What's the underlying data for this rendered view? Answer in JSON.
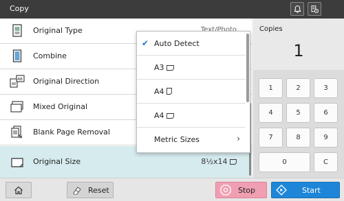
{
  "header": {
    "title": "Copy",
    "bell_icon": "bell-icon",
    "job_status_icon": "job-status-icon"
  },
  "settings": [
    {
      "label": "Original Type",
      "value": "Text/Photo",
      "icon": "original-type-icon"
    },
    {
      "label": "Combine",
      "value": "",
      "icon": "combine-icon"
    },
    {
      "label": "Original Direction",
      "value": "",
      "icon": "original-direction-icon"
    },
    {
      "label": "Mixed Original",
      "value": "",
      "icon": "mixed-original-icon"
    },
    {
      "label": "Blank Page Removal",
      "value": "",
      "icon": "blank-page-removal-icon"
    },
    {
      "label": "Original Size",
      "value": "8½x14",
      "icon": "original-size-icon"
    }
  ],
  "dropdown": {
    "items": [
      {
        "label": "Auto Detect",
        "checked": true
      },
      {
        "label": "A3",
        "paper": "landscape"
      },
      {
        "label": "A4",
        "paper": "portrait"
      },
      {
        "label": "A4",
        "paper": "landscape"
      },
      {
        "label": "Metric Sizes",
        "submenu": true
      }
    ]
  },
  "copies": {
    "label": "Copies",
    "value": "1"
  },
  "keypad": [
    "1",
    "2",
    "3",
    "4",
    "5",
    "6",
    "7",
    "8",
    "9",
    "0",
    "C"
  ],
  "footer": {
    "reset_label": "Reset",
    "stop_label": "Stop",
    "start_label": "Start"
  },
  "colors": {
    "titlebar": "#3c3c3c",
    "selected_row": "#d6ebee",
    "check": "#1a77c9",
    "stop": "#f09fb2",
    "start": "#1e86d8"
  }
}
